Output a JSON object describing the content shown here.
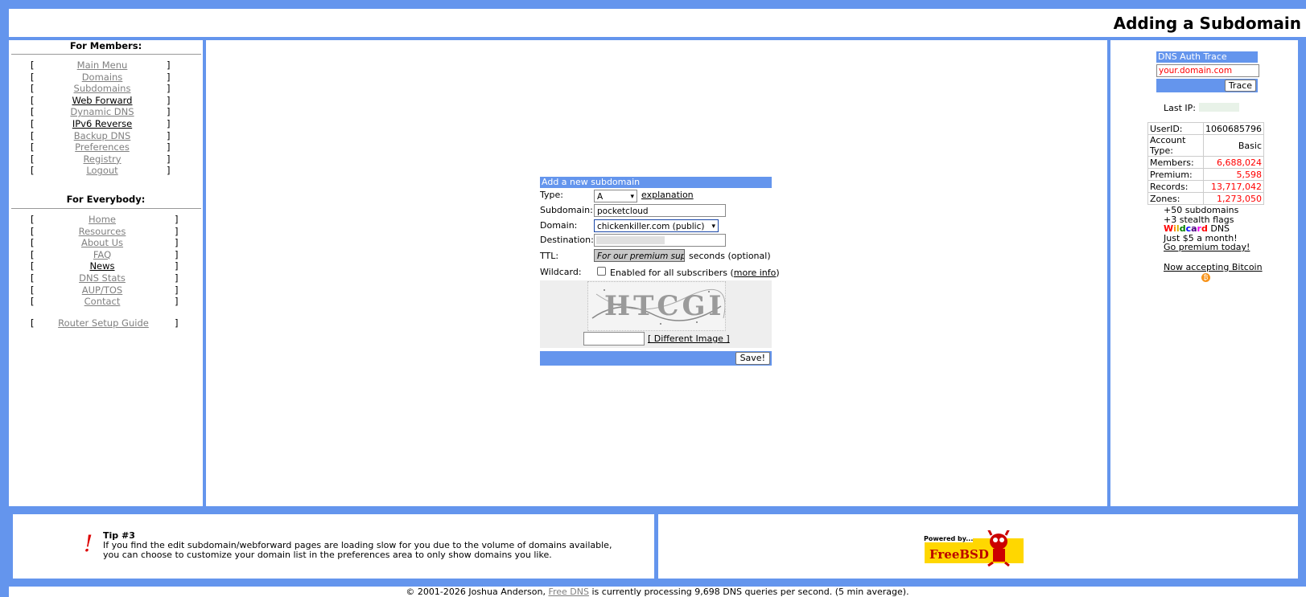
{
  "header": {
    "title": "Adding a Subdomain"
  },
  "left": {
    "members_title": "For Members:",
    "members_items": [
      {
        "label": "Main Menu",
        "style": "gray"
      },
      {
        "label": "Domains",
        "style": "gray"
      },
      {
        "label": "Subdomains",
        "style": "gray"
      },
      {
        "label": "Web Forward",
        "style": "dark"
      },
      {
        "label": "Dynamic DNS",
        "style": "gray"
      },
      {
        "label": "IPv6 Reverse",
        "style": "dark"
      },
      {
        "label": "Backup DNS",
        "style": "gray"
      },
      {
        "label": "Preferences",
        "style": "gray"
      },
      {
        "label": "Registry",
        "style": "gray"
      },
      {
        "label": "Logout",
        "style": "gray"
      }
    ],
    "everybody_title": "For Everybody:",
    "everybody_items": [
      {
        "label": "Home",
        "style": "gray"
      },
      {
        "label": "Resources",
        "style": "gray"
      },
      {
        "label": "About Us",
        "style": "gray"
      },
      {
        "label": "FAQ",
        "style": "gray"
      },
      {
        "label": "News",
        "style": "dark"
      },
      {
        "label": "DNS Stats",
        "style": "gray"
      },
      {
        "label": "AUP/TOS",
        "style": "gray"
      },
      {
        "label": "Contact",
        "style": "gray"
      }
    ],
    "router_guide": "Router Setup Guide",
    "bracket_open": "[",
    "bracket_close": "]"
  },
  "form": {
    "heading": "Add a new subdomain",
    "type_label": "Type:",
    "type_value": "A",
    "explanation_link": "explanation",
    "subdomain_label": "Subdomain:",
    "subdomain_value": "pocketcloud",
    "domain_label": "Domain:",
    "domain_value": "chickenkiller.com (public)",
    "destination_label": "Destination:",
    "ttl_label": "TTL:",
    "ttl_placeholder": "For our premium suppc",
    "ttl_suffix": "seconds (optional)",
    "wildcard_label": "Wildcard:",
    "wildcard_text": "Enabled for all subscribers (",
    "wildcard_more": "more info",
    "wildcard_close": ")",
    "captcha_text": "HTCGI",
    "different_image": "[ Different Image ]",
    "save_button": "Save!"
  },
  "right": {
    "trace_title": "DNS Auth Trace",
    "trace_placeholder": "your.domain.com",
    "trace_button": "Trace",
    "last_ip_label": "Last IP:",
    "stats": [
      {
        "label": "UserID:",
        "value": "1060685796",
        "color": "#000000"
      },
      {
        "label": "Account Type:",
        "value": "Basic",
        "color": "#000000"
      },
      {
        "label": "Members:",
        "value": "6,688,024",
        "color": "#ff0000"
      },
      {
        "label": "Premium:",
        "value": "5,598",
        "color": "#ff0000"
      },
      {
        "label": "Records:",
        "value": "13,717,042",
        "color": "#ff0000"
      },
      {
        "label": "Zones:",
        "value": "1,273,050",
        "color": "#ff0000"
      }
    ],
    "promo_line1": "+50 subdomains",
    "promo_line2": "+3 stealth flags",
    "wildcard_word": "Wildcard",
    "wildcard_dns": " DNS",
    "promo_line4": "Just $5 a month!",
    "premium_link": "Go premium today!",
    "bitcoin_link": "Now accepting Bitcoin"
  },
  "footer": {
    "tip_title": "Tip #3",
    "tip_line1": "If you find the edit subdomain/webforward pages are loading slow for you due to the volume of domains available,",
    "tip_line2": "you can choose to customize your domain list in the preferences area to only show domains you like.",
    "exclaim": "!",
    "powered_by": "Powered by...",
    "freebsd": "FreeBSD",
    "copyright_pre": "© 2001-2026 Joshua Anderson,",
    "copyright_link": "Free DNS",
    "copyright_post": "is currently processing 9,698 DNS queries per second. (5 min average)."
  },
  "colors": {
    "accent": "#6495ed",
    "red": "#ff0000"
  }
}
